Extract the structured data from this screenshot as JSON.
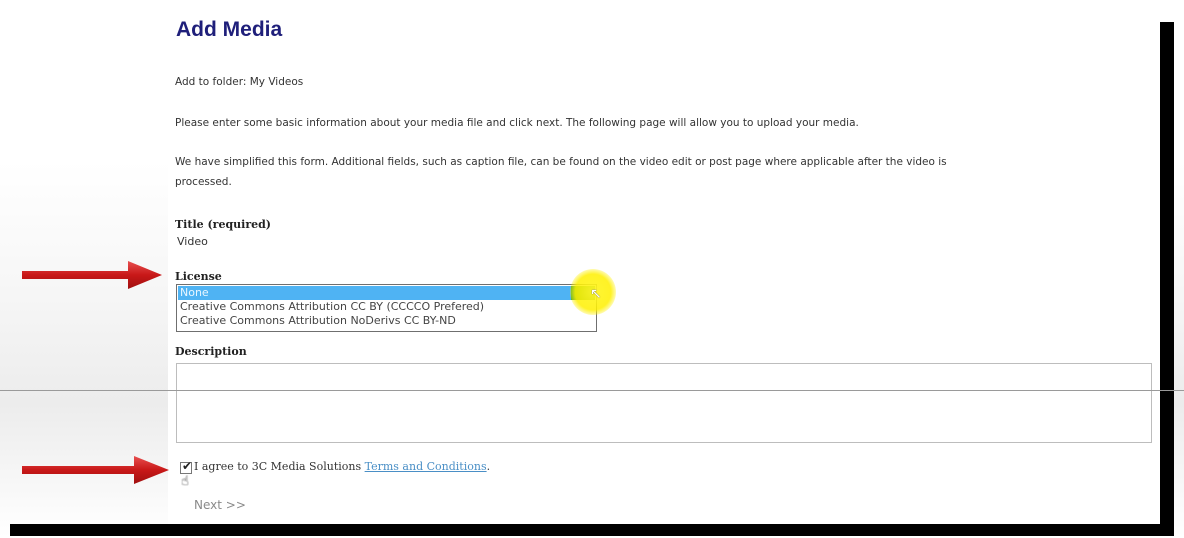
{
  "page": {
    "title": "Add Media",
    "folder_line": "Add to folder: My Videos",
    "intro_line": "Please enter some basic information about your media file and click next. The following page will allow you to upload your media.",
    "simplified_line_1": "We have simplified this form. Additional fields, such as caption file, can be found on the video edit or post page where applicable after the video is",
    "simplified_line_2": "processed."
  },
  "form": {
    "title_label": "Title (required)",
    "title_value": "Video",
    "license_label": "License",
    "license_options": [
      "None",
      "Creative Commons Attribution CC BY (CCCCO Prefered)",
      "Creative Commons Attribution NoDerivs CC BY-ND"
    ],
    "license_selected": "None",
    "description_label": "Description",
    "description_value": "",
    "agree_text": "I agree to 3C Media Solutions ",
    "terms_link": "Terms and Conditions",
    "agree_suffix": ".",
    "agree_checked": true,
    "next_label": "Next >>"
  },
  "annotations": {
    "arrow_color": "#d42020",
    "highlight_color": "#fff228"
  },
  "colors": {
    "title": "#1f1f7a",
    "selected_option": "#4fb3f3",
    "link": "#4a8fc6"
  }
}
